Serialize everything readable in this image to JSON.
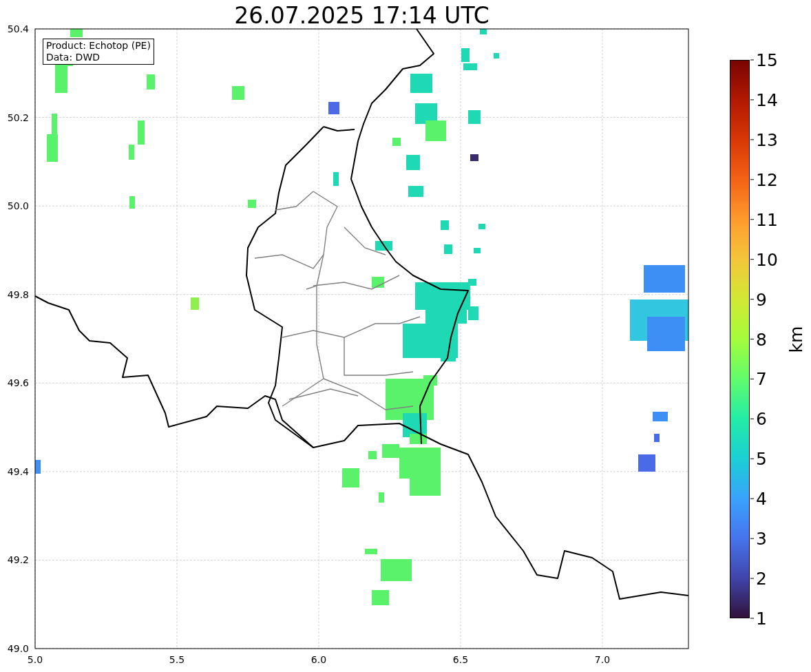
{
  "title": "26.07.2025 17:14 UTC",
  "info_box": [
    "Product: Echotop (PE)",
    "Data: DWD"
  ],
  "x_ticks": [
    "5.0",
    "5.5",
    "6.0",
    "6.5",
    "7.0"
  ],
  "y_ticks": [
    "50.4",
    "50.2",
    "50.0",
    "49.8",
    "49.6",
    "49.4",
    "49.2",
    "49.0"
  ],
  "colorbar": {
    "label": "km",
    "ticks": [
      "15",
      "14",
      "13",
      "12",
      "11",
      "10",
      "9",
      "8",
      "7",
      "6",
      "5",
      "4",
      "3",
      "2",
      "1"
    ]
  }
}
